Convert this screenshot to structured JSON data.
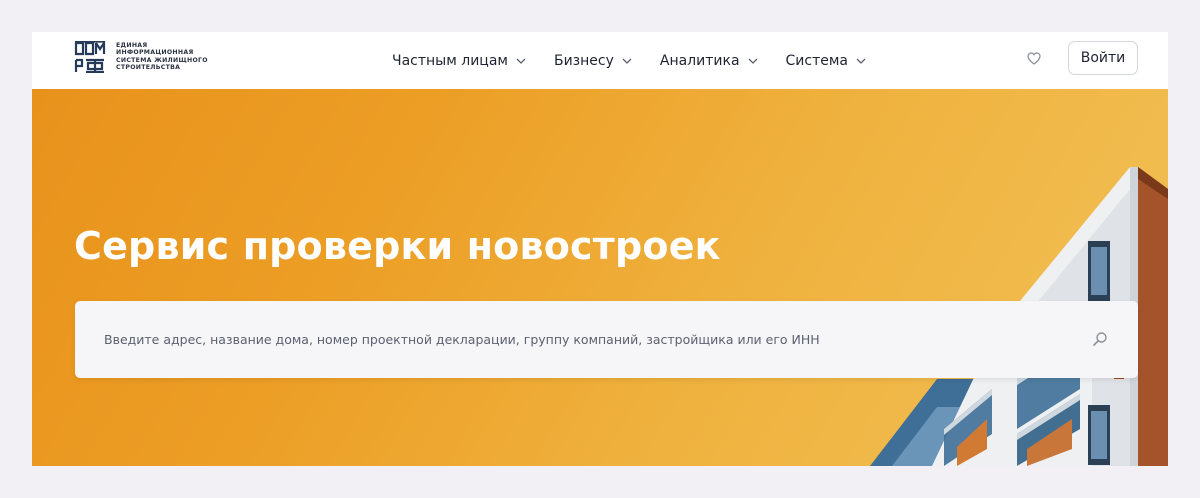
{
  "logo": {
    "mark": "ДОМ РФ",
    "lines": [
      "ЕДИНАЯ",
      "ИНФОРМАЦИОННАЯ",
      "СИСТЕМА ЖИЛИЩНОГО",
      "СТРОИТЕЛЬСТВА"
    ]
  },
  "nav": {
    "items": [
      {
        "label": "Частным лицам",
        "icon": "chevron-down-icon"
      },
      {
        "label": "Бизнесу",
        "icon": "chevron-down-icon"
      },
      {
        "label": "Аналитика",
        "icon": "chevron-down-icon"
      },
      {
        "label": "Система",
        "icon": "chevron-down-icon"
      }
    ]
  },
  "header": {
    "favorites_icon": "heart-icon",
    "login_label": "Войти"
  },
  "hero": {
    "title": "Сервис проверки новостроек",
    "search": {
      "placeholder": "Введите адрес, название дома, номер проектной декларации, группу компаний, застройщика или его ИНН",
      "value": "",
      "icon": "search-icon"
    }
  },
  "colors": {
    "accent_orange": "#E8921C",
    "text_dark": "#1F2430",
    "page_bg": "#F2EFF5"
  }
}
